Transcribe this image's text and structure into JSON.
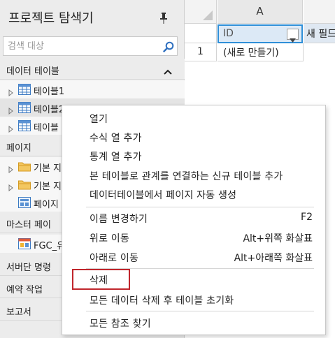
{
  "explorer": {
    "title": "프로젝트 탐색기",
    "search_placeholder": "검색 대상",
    "sections": {
      "data_tables": "데이터 테이블",
      "pages": "페이지",
      "master_pages": "마스터 페이",
      "server_commands": "서버단 명령",
      "scheduled_jobs": "예약 작업",
      "reports": "보고서"
    },
    "tables": [
      "테이블1",
      "테이블2",
      "테이블"
    ],
    "pages": [
      "기본 지",
      "기본 지",
      "페이지"
    ],
    "master_pages": [
      "FGC_유"
    ]
  },
  "grid": {
    "column_header": "A",
    "field_id": "ID",
    "field_new": "새 필드",
    "row_number": "1",
    "new_row": "(새로 만들기)"
  },
  "context_menu": {
    "items": [
      {
        "label": "열기",
        "shortcut": ""
      },
      {
        "label": "수식 열 추가",
        "shortcut": ""
      },
      {
        "label": "통계 열 추가",
        "shortcut": ""
      },
      {
        "label": "본 테이블로 관계를 연결하는 신규 테이블 추가",
        "shortcut": ""
      },
      {
        "label": "데이터테이블에서 페이지 자동 생성",
        "shortcut": ""
      },
      {
        "label": "이름 변경하기",
        "shortcut": "F2"
      },
      {
        "label": "위로 이동",
        "shortcut": "Alt+위쪽 화살표"
      },
      {
        "label": "아래로 이동",
        "shortcut": "Alt+아래쪽 화살표"
      },
      {
        "label": "삭제",
        "shortcut": ""
      },
      {
        "label": "모든 데이터 삭제 후 테이블 초기화",
        "shortcut": ""
      },
      {
        "label": "모든 참조 찾기",
        "shortcut": ""
      }
    ]
  },
  "colors": {
    "highlight": "#c0262c",
    "selection_border": "#2f8fd8",
    "panel_bg": "#ececec"
  },
  "icons": {
    "pin": "pin-icon",
    "search": "search-icon",
    "table": "table-icon",
    "folder": "folder-icon",
    "page": "page-icon",
    "master_page": "master-page-icon"
  }
}
